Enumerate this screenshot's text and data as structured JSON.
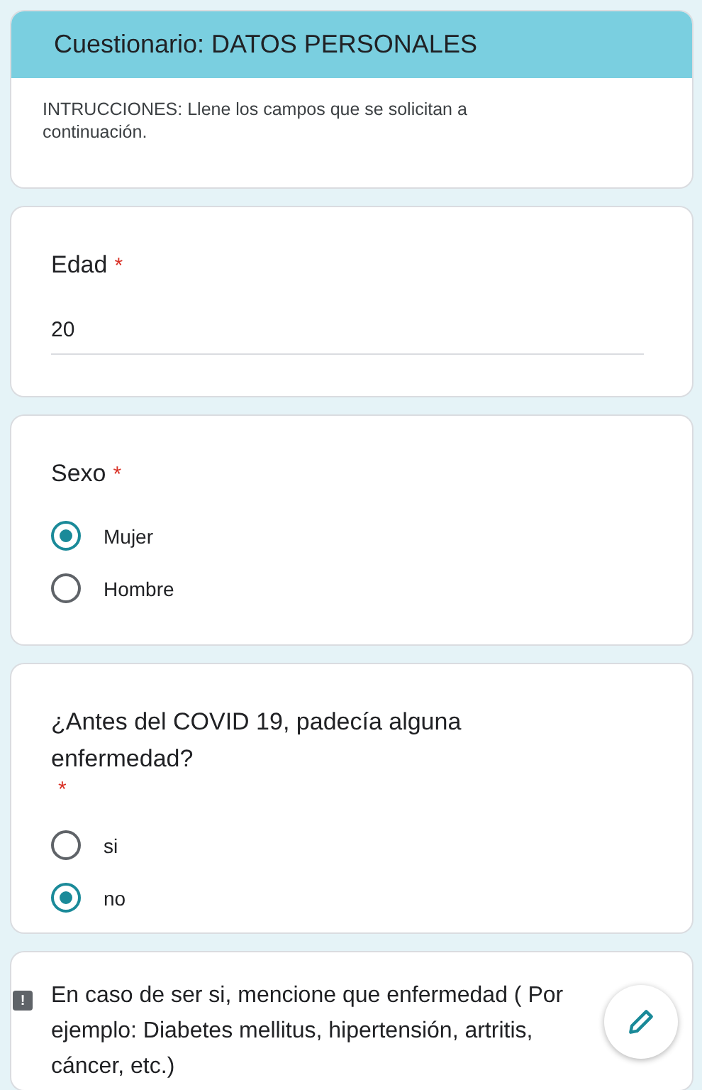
{
  "header": {
    "title": "Cuestionario: DATOS PERSONALES",
    "instructions": "INTRUCCIONES: Llene los campos que se solicitan a continuación."
  },
  "questions": [
    {
      "kind": "text",
      "label": "Edad",
      "required_mark": "*",
      "value": "20"
    },
    {
      "kind": "radio",
      "label": "Sexo",
      "required_mark": "*",
      "options": [
        {
          "label": "Mujer",
          "selected": true
        },
        {
          "label": "Hombre",
          "selected": false
        }
      ]
    },
    {
      "kind": "radio",
      "label": "¿Antes del COVID 19, padecía alguna enfermedad?",
      "required_mark": "*",
      "options": [
        {
          "label": "si",
          "selected": false
        },
        {
          "label": "no",
          "selected": true
        }
      ]
    },
    {
      "kind": "partial",
      "label": "En caso de ser si, mencione que enfermedad ( Por ejemplo: Diabetes mellitus, hipertensión, artritis, cáncer, etc.)"
    }
  ],
  "report_badge": "!"
}
